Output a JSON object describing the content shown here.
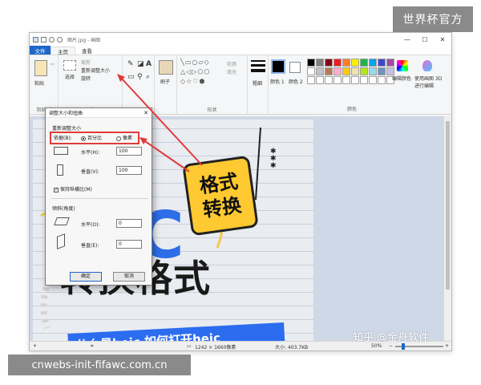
{
  "watermark": {
    "top_right": "世界杯官方",
    "bottom_left": "cnwebs-init-fifawc.com.cn",
    "zhihu": "知乎 @金舟软件"
  },
  "window": {
    "title": "图片.jpg - 画图"
  },
  "tabs": {
    "file": "文件",
    "home": "主页",
    "view": "查看"
  },
  "ribbon": {
    "clipboard": {
      "paste": "粘贴",
      "label": "剪贴板"
    },
    "image": {
      "select": "选择",
      "crop": "裁剪",
      "resize": "重新调整大小",
      "rotate": "旋转",
      "label": "图像"
    },
    "tools": {
      "label": "工具"
    },
    "brushes": {
      "label": "刷子"
    },
    "shapes": {
      "outline": "轮廓",
      "fill": "填充",
      "label": "形状"
    },
    "size": {
      "label": "粗细"
    },
    "color1": "颜色 1",
    "color2": "颜色 2",
    "colors_label": "颜色",
    "edit_colors": "编辑颜色",
    "paint3d": "使用画图 3D 进行编辑"
  },
  "colors": {
    "row1": [
      "#000000",
      "#7f7f7f",
      "#880015",
      "#ed1c24",
      "#ff7f27",
      "#fff200",
      "#22b14c",
      "#00a2e8",
      "#3f48cc",
      "#a349a4"
    ],
    "row2": [
      "#ffffff",
      "#c3c3c3",
      "#b97a57",
      "#ffaec9",
      "#ffc90e",
      "#efe4b0",
      "#b5e61d",
      "#99d9ea",
      "#7092be",
      "#c8bfe7"
    ],
    "row3": [
      "#ffffff",
      "#ffffff",
      "#ffffff",
      "#ffffff",
      "#ffffff",
      "#ffffff",
      "#ffffff",
      "#ffffff",
      "#ffffff",
      "#ffffff"
    ]
  },
  "poster": {
    "sticker_line1": "格式",
    "sticker_line2": "转换",
    "big_c": "C",
    "big_text": "转换格式",
    "band_text": "什么是heic  如何打开heic"
  },
  "dialog": {
    "title": "调整大小和扭曲",
    "resize_section": "重新调整大小",
    "by_label": "依据(B):",
    "percent": "百分比",
    "pixels": "像素",
    "horizontal": "水平(H):",
    "horizontal_value": "100",
    "vertical": "垂直(V):",
    "vertical_value": "100",
    "keep_ratio": "保持纵横比(M)",
    "skew_section": "倾斜(角度)",
    "skew_h": "水平(O):",
    "skew_h_value": "0",
    "skew_v": "垂直(E):",
    "skew_v_value": "0",
    "ok": "确定",
    "cancel": "取消"
  },
  "status": {
    "dimensions": "1242 × 1660像素",
    "filesize": "大小: 403.7KB",
    "zoom": "50%"
  }
}
